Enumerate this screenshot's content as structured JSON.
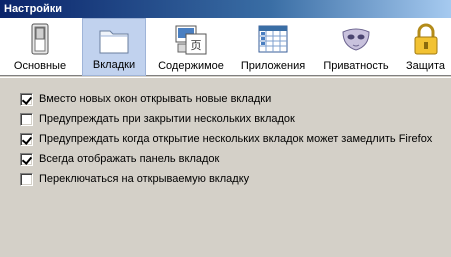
{
  "window": {
    "title": "Настройки"
  },
  "panes": [
    {
      "label": "Основные",
      "icon": "switch-icon",
      "selected": false
    },
    {
      "label": "Вкладки",
      "icon": "folder-tabs-icon",
      "selected": true
    },
    {
      "label": "Содержимое",
      "icon": "content-icon",
      "selected": false
    },
    {
      "label": "Приложения",
      "icon": "applications-icon",
      "selected": false
    },
    {
      "label": "Приватность",
      "icon": "mask-icon",
      "selected": false
    },
    {
      "label": "Защита",
      "icon": "lock-icon",
      "selected": false
    }
  ],
  "tabs_options": [
    {
      "label": "Вместо новых окон открывать новые вкладки",
      "checked": true
    },
    {
      "label": "Предупреждать при закрытии нескольких вкладок",
      "checked": false
    },
    {
      "label": "Предупреждать когда открытие нескольких вкладок может замедлить Firefox",
      "checked": true
    },
    {
      "label": "Всегда отображать панель вкладок",
      "checked": true
    },
    {
      "label": "Переключаться на открываемую вкладку",
      "checked": false
    }
  ]
}
